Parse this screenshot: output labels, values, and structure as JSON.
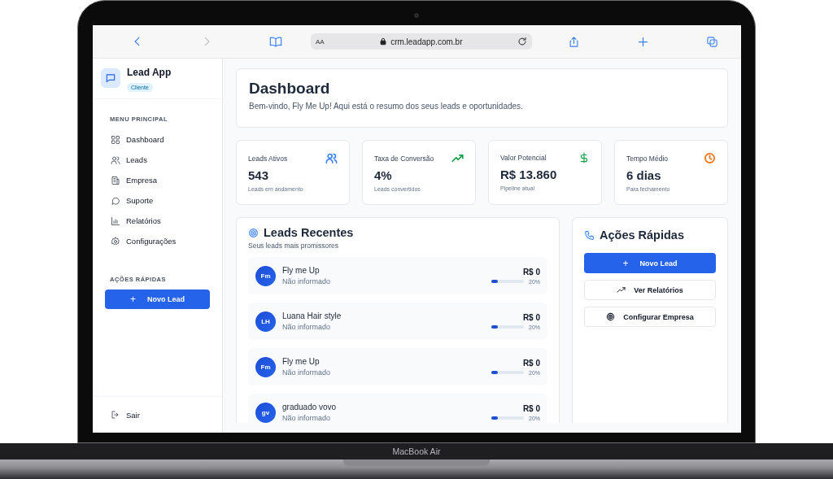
{
  "browser": {
    "text_size": "AA",
    "url": "crm.leadapp.com.br"
  },
  "sidebar": {
    "app_name": "Lead App",
    "badge": "Cliente",
    "menu_title": "MENU PRINCIPAL",
    "items": [
      {
        "label": "Dashboard"
      },
      {
        "label": "Leads"
      },
      {
        "label": "Empresa"
      },
      {
        "label": "Suporte"
      },
      {
        "label": "Relatórios"
      },
      {
        "label": "Configurações"
      }
    ],
    "quick_title": "AÇÕES RÁPIDAS",
    "quick_button": {
      "icon": "+",
      "label": "Novo Lead"
    },
    "logout": "Sair"
  },
  "header": {
    "title": "Dashboard",
    "subtitle": "Bem-vindo, Fly Me Up! Aqui está o resumo dos seus leads e oportunidades."
  },
  "stats": [
    {
      "label": "Leads Ativos",
      "value": "543",
      "note": "Leads em andamento",
      "color": "#3b82f6"
    },
    {
      "label": "Taxa de Conversão",
      "value": "4%",
      "note": "Leads convertidos",
      "color": "#16a34a"
    },
    {
      "label": "Valor Potencial",
      "value": "R$ 13.860",
      "note": "Pipeline atual",
      "color": "#16a34a"
    },
    {
      "label": "Tempo Médio",
      "value": "6 dias",
      "note": "Para fechamento",
      "color": "#f97316"
    }
  ],
  "recent_leads": {
    "title": "Leads Recentes",
    "subtitle": "Seus leads mais promissores",
    "rows": [
      {
        "initials": "Fm",
        "name": "Fly me Up",
        "detail": "Não informado",
        "value": "R$ 0",
        "level": 0.2,
        "percent": "20%"
      },
      {
        "initials": "LH",
        "name": "Luana Hair style",
        "detail": "Não informado",
        "value": "R$ 0",
        "level": 0.2,
        "percent": "20%"
      },
      {
        "initials": "Fm",
        "name": "Fly me Up",
        "detail": "Não informado",
        "value": "R$ 0",
        "level": 0.2,
        "percent": "20%"
      },
      {
        "initials": "gv",
        "name": "graduado vovo",
        "detail": "Não informado",
        "value": "R$ 0",
        "level": 0.2,
        "percent": "20%"
      }
    ]
  },
  "quick_actions": {
    "title": "Ações Rápidas",
    "buttons": [
      {
        "kind": "primary",
        "icon": "+",
        "label": "Novo Lead"
      },
      {
        "kind": "secondary",
        "label": "Ver Relatórios"
      },
      {
        "kind": "secondary",
        "label": "Configurar Empresa"
      }
    ]
  },
  "device": {
    "label": "MacBook Air"
  }
}
